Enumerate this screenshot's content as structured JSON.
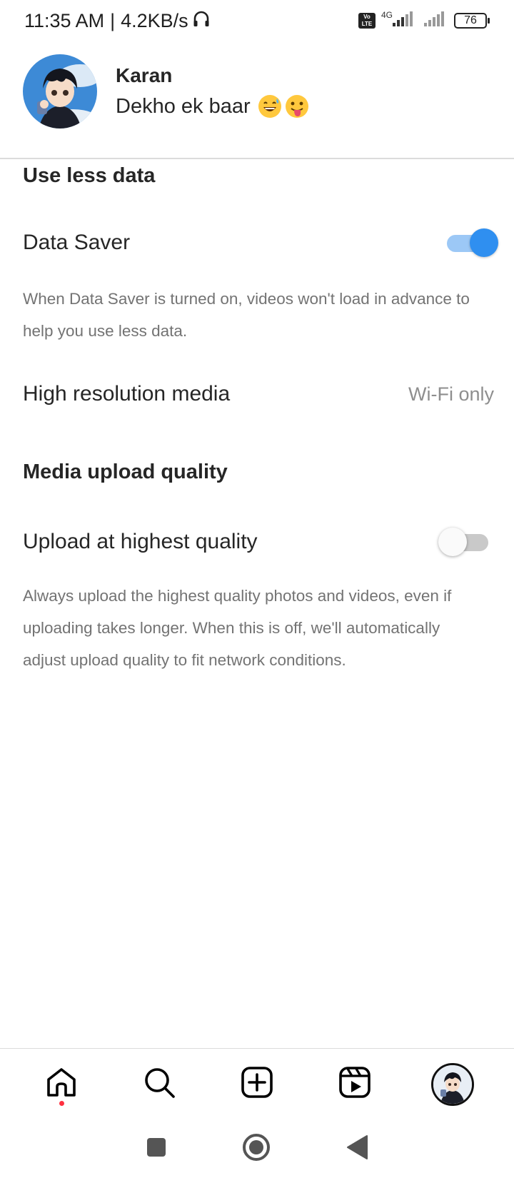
{
  "status_bar": {
    "time": "11:35 AM",
    "separator": "|",
    "speed": "4.2KB/s",
    "network_type": "4G",
    "volte_label": "Vo LTE",
    "battery": "76"
  },
  "profile": {
    "name": "Karan",
    "bio": "Dekho ek baar"
  },
  "sections": {
    "use_less_data": {
      "heading": "Use less data",
      "data_saver_label": "Data Saver",
      "data_saver_on": true,
      "data_saver_desc": "When Data Saver is turned on, videos won't load in advance to help you use less data.",
      "high_res_label": "High resolution media",
      "high_res_value": "Wi-Fi only"
    },
    "media_upload": {
      "heading": "Media upload quality",
      "upload_label": "Upload at highest quality",
      "upload_on": false,
      "upload_desc": "Always upload the highest quality photos and videos, even if uploading takes longer. When this is off, we'll automatically adjust upload quality to fit network conditions."
    }
  },
  "bottom_nav": {
    "items": [
      "home-icon",
      "search-icon",
      "create-icon",
      "reels-icon",
      "profile-avatar"
    ],
    "active": "home-icon"
  },
  "colors": {
    "toggle_on_thumb": "#2f8ff0",
    "toggle_on_track": "#9cc8f6",
    "notification_dot": "#ff3040"
  }
}
